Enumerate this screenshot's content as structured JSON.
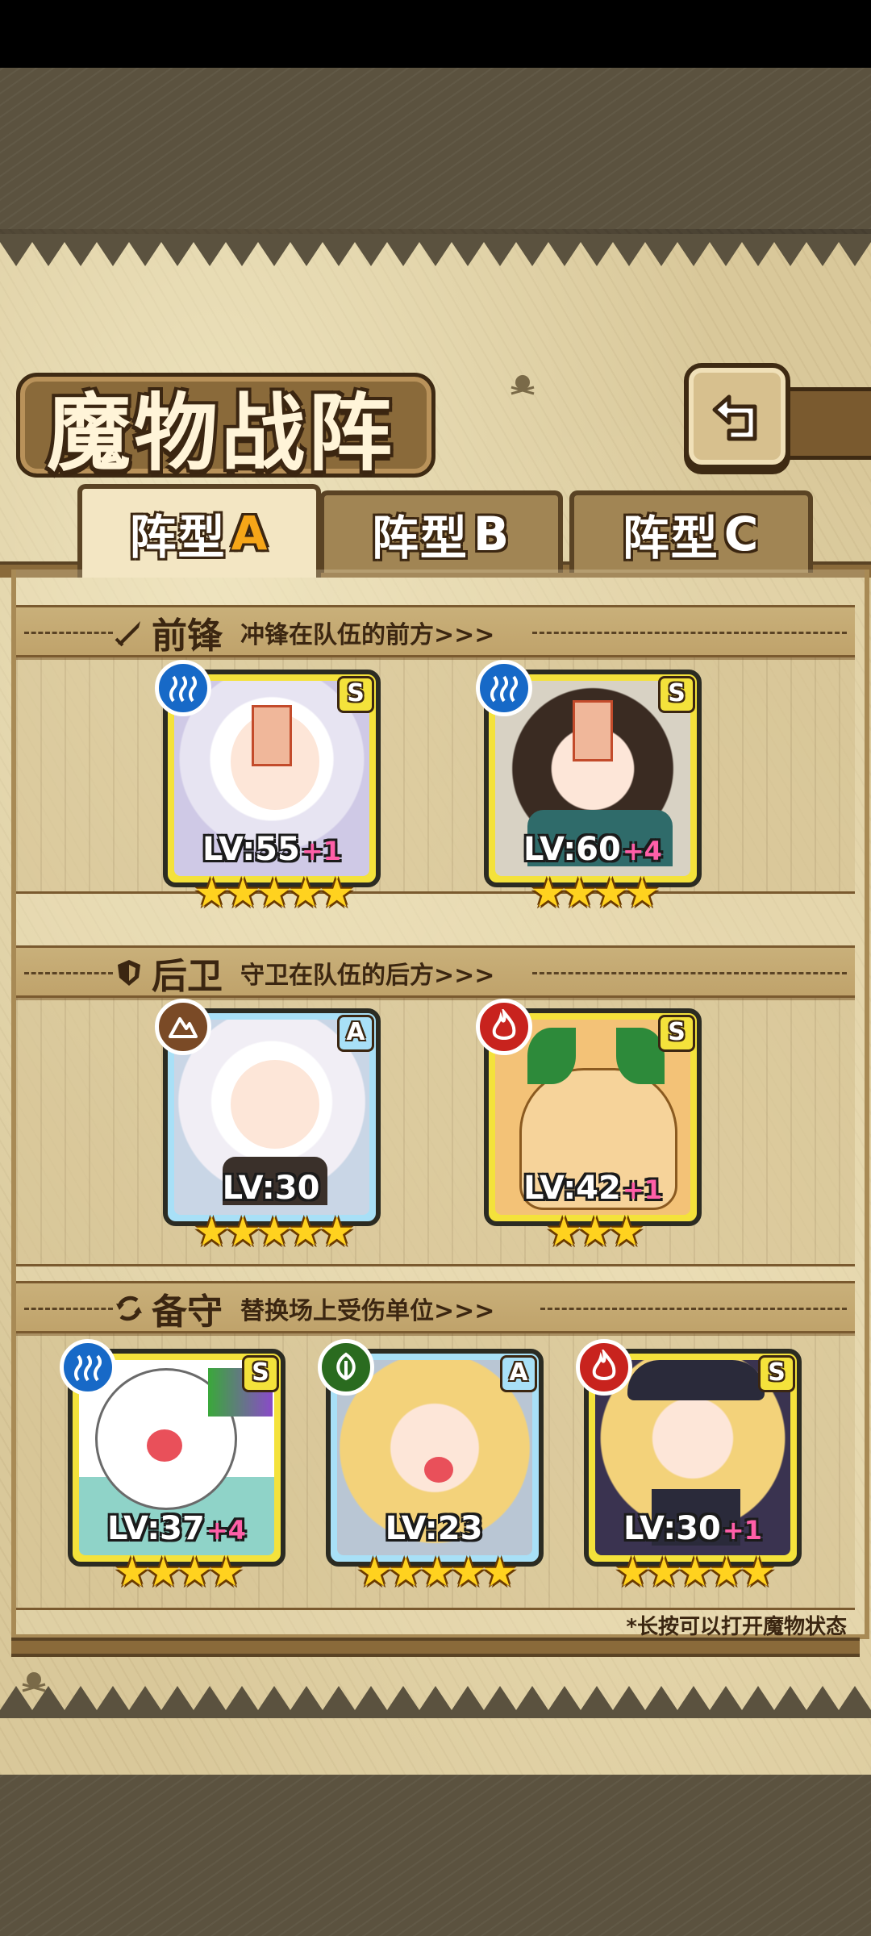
{
  "title": "魔物战阵",
  "tabs": [
    {
      "label": "阵型",
      "letter": "A",
      "active": true
    },
    {
      "label": "阵型",
      "letter": "B",
      "active": false
    },
    {
      "label": "阵型",
      "letter": "C",
      "active": false
    }
  ],
  "sections": {
    "front": {
      "name": "前锋",
      "desc": "冲锋在队伍的前方>>>",
      "icon": "sword-icon"
    },
    "back": {
      "name": "后卫",
      "desc": "守卫在队伍的后方>>>",
      "icon": "shield-icon"
    },
    "reserve": {
      "name": "备守",
      "desc": "替换场上受伤单位>>>",
      "icon": "swap-icon"
    }
  },
  "cards": {
    "front1": {
      "rank": "S",
      "element": "water-icon",
      "lv": "LV:55",
      "plus": "+1",
      "stars": "★★★★★"
    },
    "front2": {
      "rank": "S",
      "element": "water-icon",
      "lv": "LV:60",
      "plus": "+4",
      "stars": "★★★★"
    },
    "back1": {
      "rank": "A",
      "element": "rock-icon",
      "lv": "LV:30",
      "plus": "",
      "stars": "★★★★★"
    },
    "back2": {
      "rank": "S",
      "element": "fire-icon",
      "lv": "LV:42",
      "plus": "+1",
      "stars": "★★★"
    },
    "res1": {
      "rank": "S",
      "element": "water-icon",
      "lv": "LV:37",
      "plus": "+4",
      "stars": "★★★★"
    },
    "res2": {
      "rank": "A",
      "element": "grass-icon",
      "lv": "LV:23",
      "plus": "",
      "stars": "★★★★★"
    },
    "res3": {
      "rank": "S",
      "element": "fire-icon",
      "lv": "LV:30",
      "plus": "+1",
      "stars": "★★★★★"
    }
  },
  "footnote": "*长按可以打开魔物状态",
  "colors": {
    "rank_s": "#f4e23b",
    "rank_a": "#a8e0f7",
    "plus": "#ff5fa8",
    "star": "#ffd21f",
    "parchment": "#d9c89a"
  }
}
